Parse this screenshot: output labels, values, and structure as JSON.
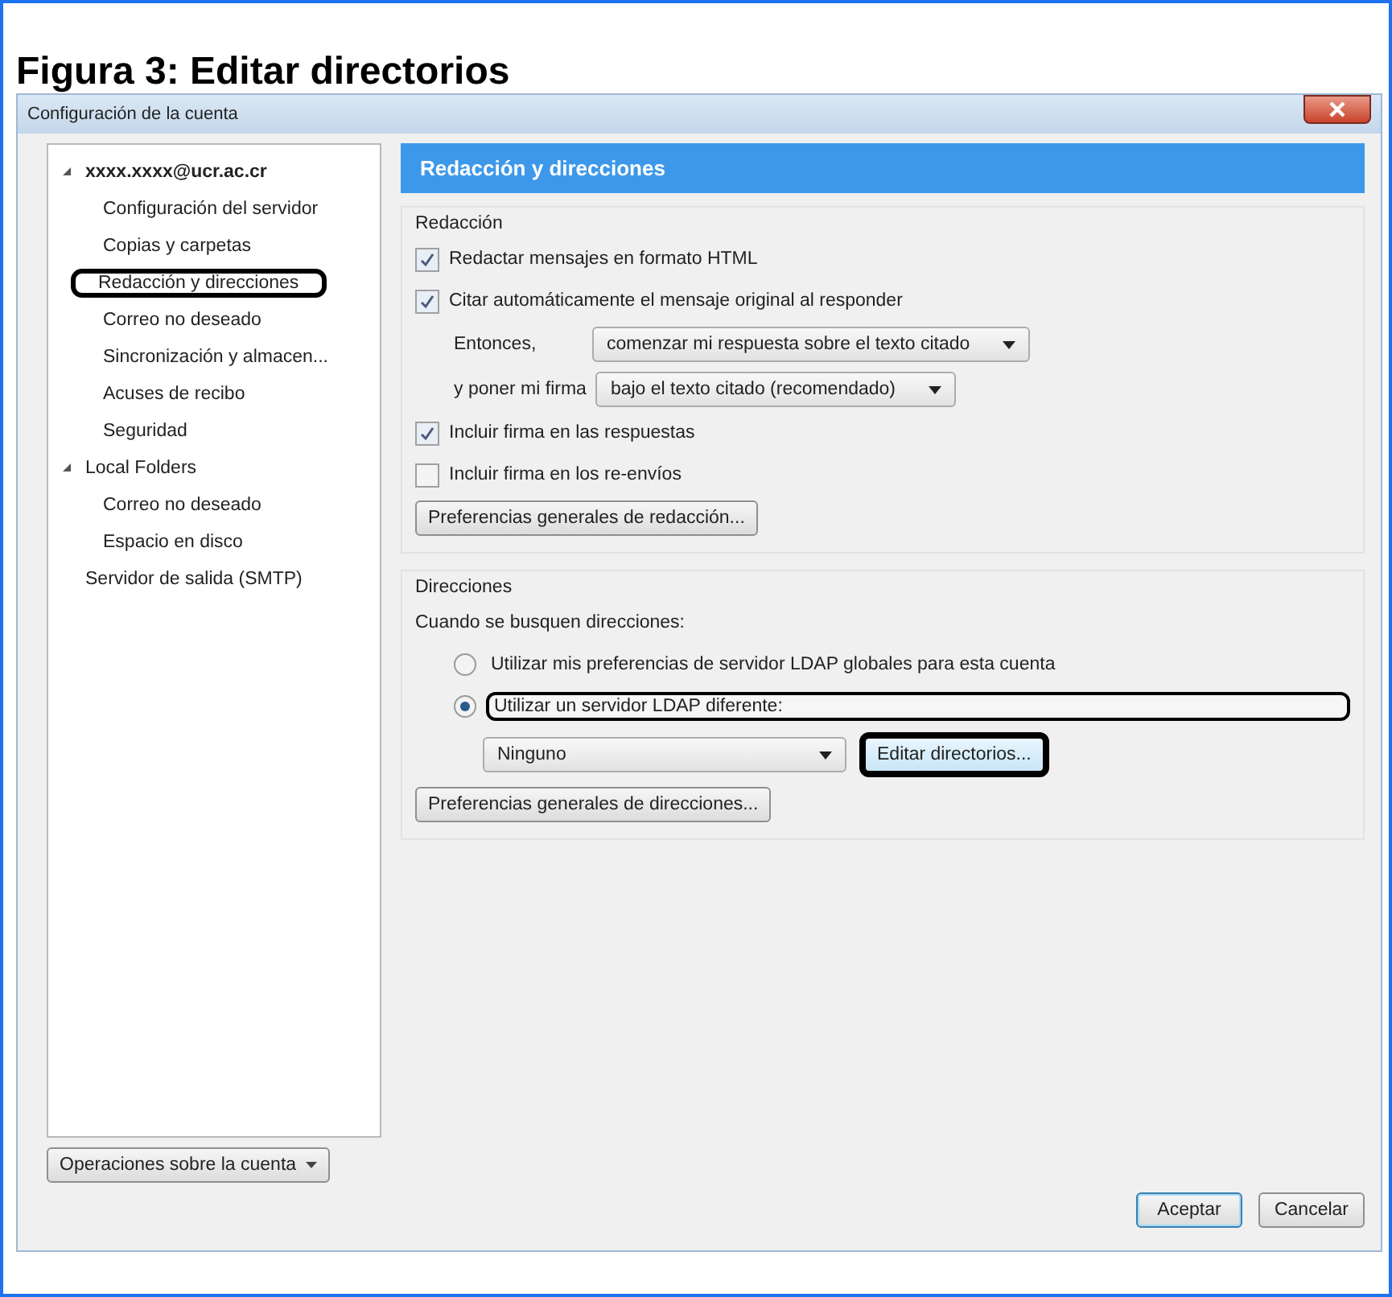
{
  "figure_title": "Figura 3: Editar directorios",
  "window": {
    "title": "Configuración de la cuenta"
  },
  "sidebar": {
    "items": [
      {
        "label": "xxxx.xxxx@ucr.ac.cr",
        "kind": "account",
        "expanded": true,
        "highlighted": false,
        "children": [
          {
            "label": "Configuración del servidor",
            "highlighted": false
          },
          {
            "label": "Copias y carpetas",
            "highlighted": false
          },
          {
            "label": "Redacción y direcciones",
            "highlighted": true
          },
          {
            "label": "Correo no deseado",
            "highlighted": false
          },
          {
            "label": "Sincronización y almacen...",
            "highlighted": false
          },
          {
            "label": "Acuses de recibo",
            "highlighted": false
          },
          {
            "label": "Seguridad",
            "highlighted": false
          }
        ]
      },
      {
        "label": "Local Folders",
        "kind": "folder",
        "expanded": true,
        "highlighted": false,
        "children": [
          {
            "label": "Correo no deseado",
            "highlighted": false
          },
          {
            "label": "Espacio en disco",
            "highlighted": false
          }
        ]
      },
      {
        "label": "Servidor de salida (SMTP)",
        "kind": "plain",
        "highlighted": false
      }
    ],
    "account_button": "Operaciones sobre la cuenta"
  },
  "panel": {
    "header": "Redacción y direcciones",
    "sections": [
      {
        "title": "Redacción",
        "items": [
          {
            "kind": "checkbox",
            "label": "Redactar mensajes en formato HTML",
            "checked": true
          },
          {
            "kind": "checkbox",
            "label": "Citar automáticamente el mensaje original al responder",
            "checked": true
          },
          {
            "kind": "select",
            "label": "Entonces,",
            "value": "comenzar mi respuesta sobre el texto citado"
          },
          {
            "kind": "select",
            "label": "y poner mi firma",
            "value": "bajo el texto citado (recomendado)"
          },
          {
            "kind": "checkbox",
            "label": "Incluir firma en las respuestas",
            "checked": true
          },
          {
            "kind": "checkbox",
            "label": "Incluir firma en los re-envíos",
            "checked": false
          },
          {
            "kind": "button",
            "label": "Preferencias generales de redacción..."
          }
        ]
      },
      {
        "title": "Direcciones",
        "items": [
          {
            "kind": "text",
            "label": "Cuando se busquen direcciones:"
          },
          {
            "kind": "radio",
            "label": "Utilizar mis preferencias de servidor LDAP globales para esta cuenta",
            "selected": false,
            "highlighted": false
          },
          {
            "kind": "radio",
            "label": "Utilizar un servidor LDAP diferente:",
            "selected": true,
            "highlighted": true
          },
          {
            "kind": "select_button",
            "value": "Ninguno",
            "button": "Editar directorios...",
            "highlighted": true
          },
          {
            "kind": "button",
            "label": "Preferencias generales de direcciones..."
          }
        ]
      }
    ]
  },
  "dialog_buttons": [
    {
      "label": "Aceptar",
      "default": true
    },
    {
      "label": "Cancelar",
      "default": false
    }
  ]
}
